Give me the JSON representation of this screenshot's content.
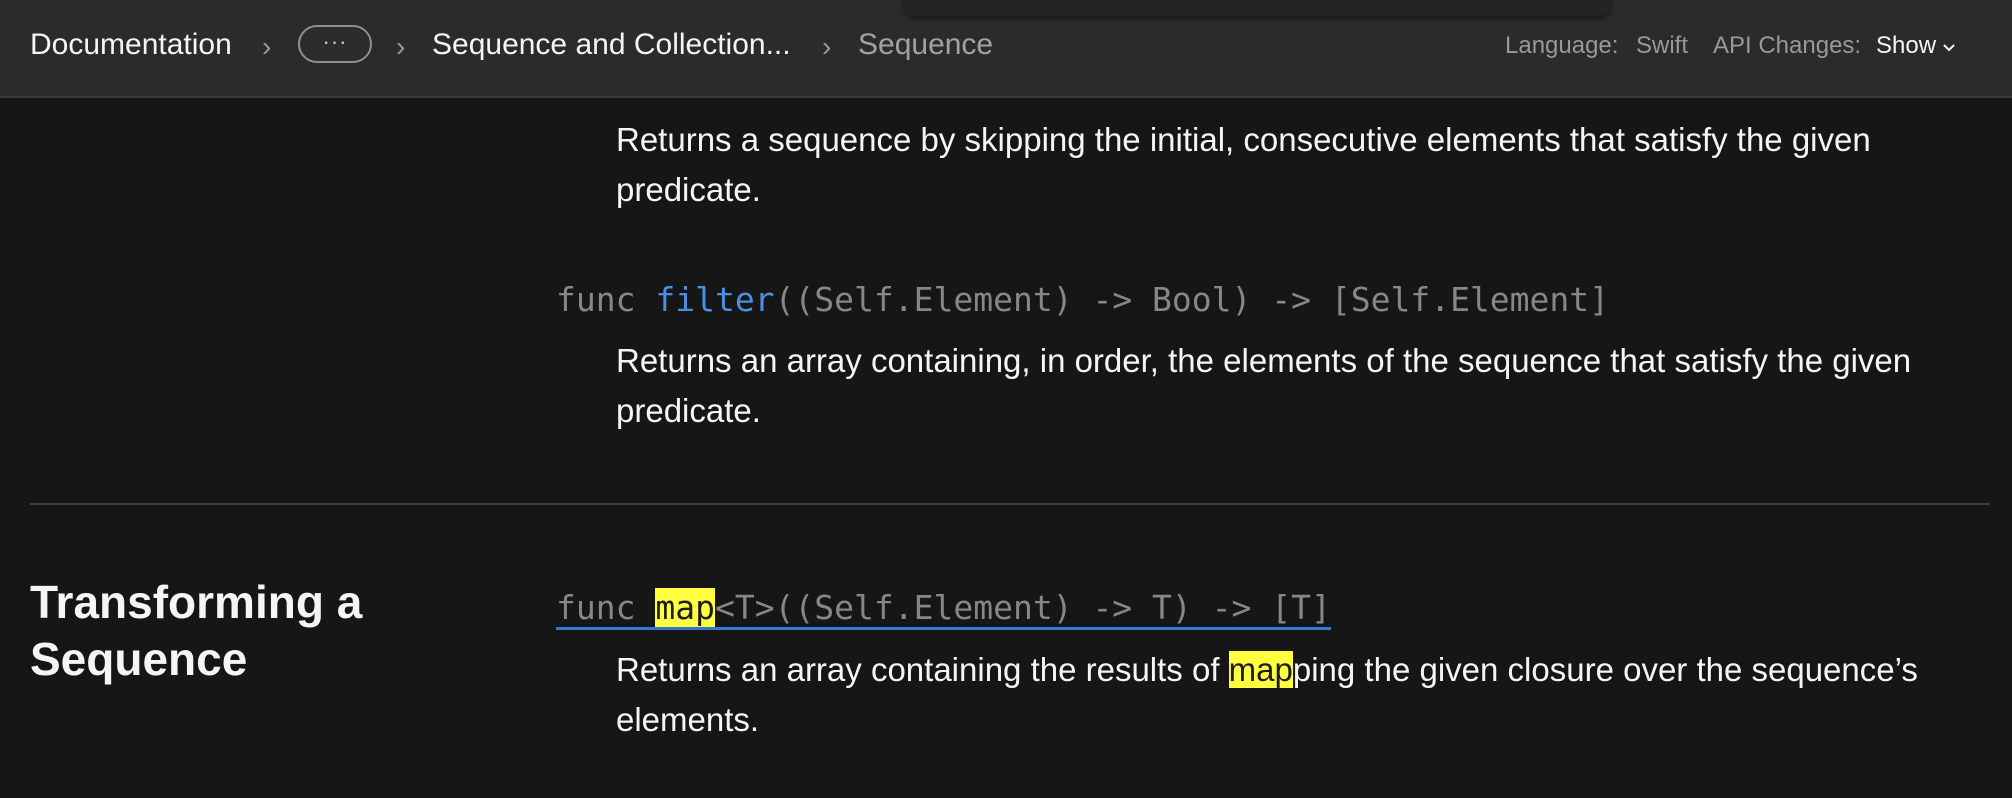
{
  "nav": {
    "breadcrumbs": {
      "docs": "Documentation",
      "more": "···",
      "collection": "Sequence and Collection...",
      "current": "Sequence"
    },
    "language": {
      "label": "Language:",
      "value": "Swift"
    },
    "api_changes": {
      "label": "API Changes:",
      "value": "Show"
    }
  },
  "items": {
    "drop_while": {
      "description": "Returns a sequence by skipping the initial, consecutive elements that satisfy the given predicate."
    },
    "filter": {
      "prefix": "func ",
      "name": "filter",
      "signature": "((Self.Element) -> Bool) -> [Self.Element]",
      "description": "Returns an array containing, in order, the elements of the sequence that satisfy the given predicate."
    }
  },
  "sections": {
    "transforming": {
      "title": "Transforming a Sequence",
      "map": {
        "prefix": "func ",
        "name_highlight": "map",
        "signature": "<T>((Self.Element) -> T) -> [T]",
        "desc_before": "Returns an array containing the results of ",
        "desc_highlight": "map",
        "desc_after": "ping the given closure over the sequence’s elements."
      }
    }
  },
  "colors": {
    "background": "#161616",
    "navbar": "#2b2b2b",
    "link_blue": "#4a90e2",
    "highlight": "#ffff40",
    "code_gray": "#86868b"
  }
}
